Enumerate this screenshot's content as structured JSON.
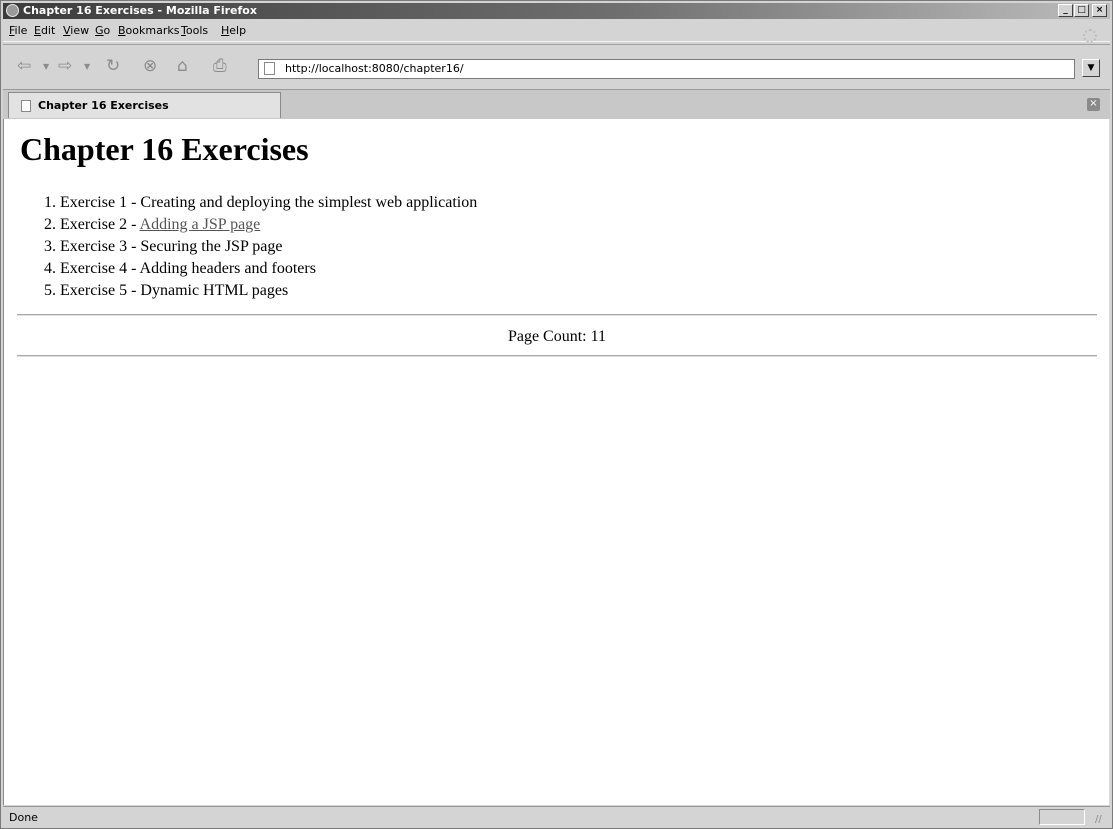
{
  "window": {
    "title": "Chapter 16 Exercises - Mozilla Firefox",
    "min_glyph": "_",
    "max_glyph": "□",
    "close_glyph": "×"
  },
  "menu": {
    "file": {
      "u": "F",
      "rest": "ile"
    },
    "edit": {
      "u": "E",
      "rest": "dit"
    },
    "view": {
      "u": "V",
      "rest": "iew"
    },
    "go": {
      "u": "G",
      "rest": "o"
    },
    "bookmarks": {
      "u": "B",
      "rest": "ookmarks"
    },
    "tools": {
      "u": "T",
      "rest": "ools"
    },
    "help": {
      "u": "H",
      "rest": "elp"
    }
  },
  "toolbar": {
    "back_glyph": "⇦",
    "forward_glyph": "⇨",
    "dropdown_glyph": "▼",
    "reload_glyph": "↻",
    "stop_glyph": "⊗",
    "home_glyph": "⌂",
    "print_glyph": "⎙",
    "url": "http://localhost:8080/chapter16/",
    "url_dropdown_glyph": "▼"
  },
  "tabs": {
    "active_label": "Chapter 16 Exercises",
    "close_glyph": "×"
  },
  "page": {
    "heading": "Chapter 16 Exercises",
    "exercises": [
      "Exercise 1 - Creating and deploying the simplest web application",
      "Exercise 2 - ",
      "Exercise 3 - Securing the JSP page",
      "Exercise 4 - Adding headers and footers",
      "Exercise 5 - Dynamic HTML pages"
    ],
    "exercise2_link": "Adding a JSP page",
    "page_count": "Page Count: 11"
  },
  "status": {
    "text": "Done",
    "grip_glyph": "//"
  },
  "colors": {
    "link": "#555555",
    "content_bg": "#ffffff",
    "chrome_bg": "#d4d4d4"
  }
}
